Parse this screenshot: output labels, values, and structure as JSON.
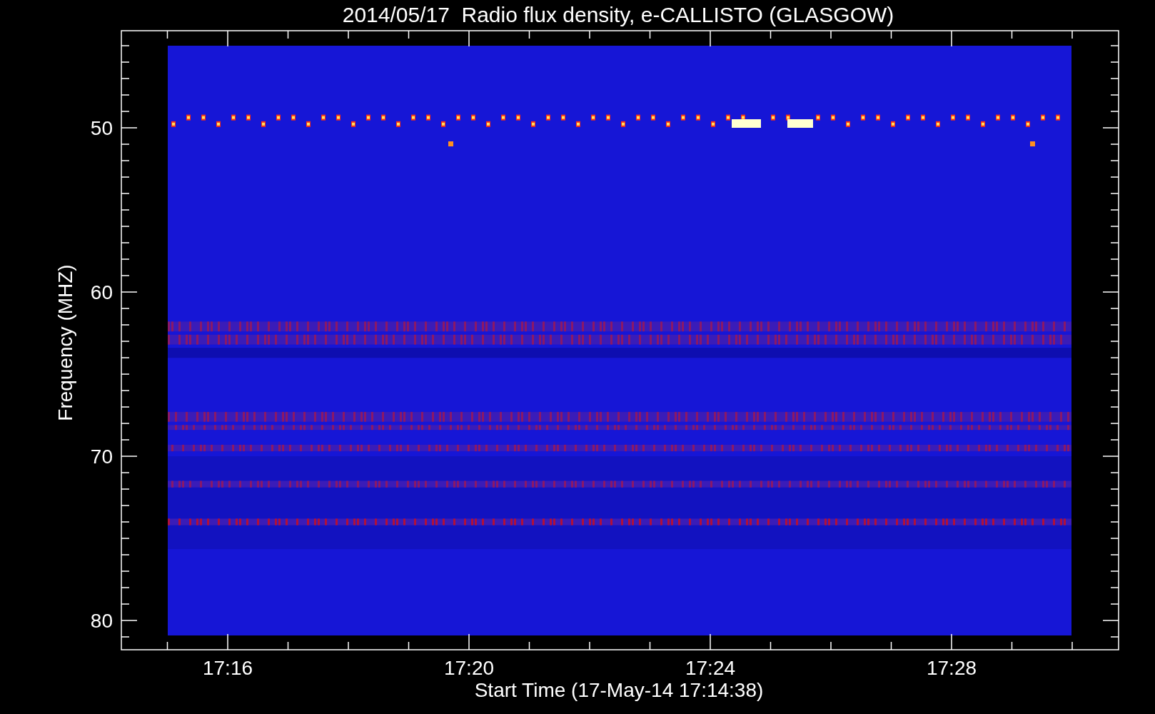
{
  "title": "2014/05/17  Radio flux density, e-CALLISTO (GLASGOW)",
  "y_axis": {
    "label": "Frequency (MHZ)",
    "ticks": [
      "50",
      "60",
      "70",
      "80"
    ]
  },
  "x_axis": {
    "label": "Start Time (17-May-14 17:14:38)",
    "ticks": [
      "17:16",
      "17:20",
      "17:24",
      "17:28"
    ]
  }
}
